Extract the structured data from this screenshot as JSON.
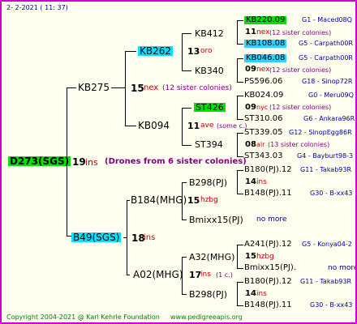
{
  "header": {
    "date": "2-   2-2021  ( 11:  37)"
  },
  "root": {
    "id": "D273(SGS)",
    "year": "19",
    "breed": "ins",
    "note": "(Drones from 6 sister colonies)"
  },
  "sire": {
    "id": "KB275",
    "year": "15",
    "breed": "nex",
    "note": "(12 sister colonies)",
    "grand_sire": {
      "id": "KB262",
      "year": "13",
      "breed": "oro",
      "ggs": {
        "id": "KB412",
        "year": "11",
        "breed": "nex",
        "note": "(12 sister colonies)",
        "father": "KB220.09",
        "father_loc": "G1 - Maced08Q",
        "mother": "KB108.08",
        "mother_loc": "G5 - Carpath00R"
      },
      "ggd": {
        "id": "KB340",
        "year": "09",
        "breed": "nex",
        "note": "(12 sister colonies)",
        "father": "KB046.08",
        "father_loc": "G5 - Carpath00R",
        "mother": "PS596.06",
        "mother_loc": "G18 - Sinop72R"
      }
    },
    "grand_dam": {
      "id": "KB094",
      "year": "11",
      "breed": "ave",
      "note": "(some c.)",
      "ggs": {
        "id": "ST426",
        "year": "09",
        "breed": "nyc",
        "note": "(12 sister colonies)",
        "father": "KB024.09",
        "father_loc": "G0 - Meru09Q",
        "mother": "ST310.06",
        "mother_loc": "G6 - Ankara96R"
      },
      "ggd": {
        "id": "ST394",
        "year": "08",
        "breed": "alr",
        "note": "(13 sister colonies)",
        "father": "ST339.05",
        "father_loc": "G12 - SinopEgg86R",
        "mother": "ST343.03",
        "mother_loc": "G4 - Bayburt98-3"
      }
    }
  },
  "dam": {
    "id": "B49(SGS)",
    "year": "18",
    "breed": "ins",
    "grand_sire": {
      "id": "B184(MHG)",
      "year": "15",
      "breed": "hzbg",
      "ggs": {
        "id": "B298(PJ)",
        "year": "14",
        "breed": "ins",
        "father": "B180(PJ).12",
        "father_loc": "G11 - Takab93R",
        "mother": "B148(PJ).11",
        "mother_loc": "G30 - B-xx43"
      },
      "ggd": {
        "id": "Bmixx15(PJ)",
        "note": "no more"
      }
    },
    "grand_dam": {
      "id": "A02(MHG)",
      "year": "17",
      "breed": "ins",
      "note": "(1 c.)",
      "ggs": {
        "id": "A32(MHG)",
        "year": "15",
        "breed": "hzbg",
        "father": "A241(PJ).12",
        "father_loc": "G5 - Konya04-2",
        "mother": "Bmixx15(PJ).",
        "mother_loc": "no more"
      },
      "ggd": {
        "id": "B298(PJ)",
        "year": "14",
        "breed": "ins",
        "father": "B180(PJ).12",
        "father_loc": "G11 - Takab93R",
        "mother": "B148(PJ).11",
        "mother_loc": "G30 - B-xx43"
      }
    }
  },
  "footer": {
    "copyright": "Copyright 2004-2021 @ Karl Kehrle Foundation",
    "site": "www.pedigreeapis.org"
  }
}
